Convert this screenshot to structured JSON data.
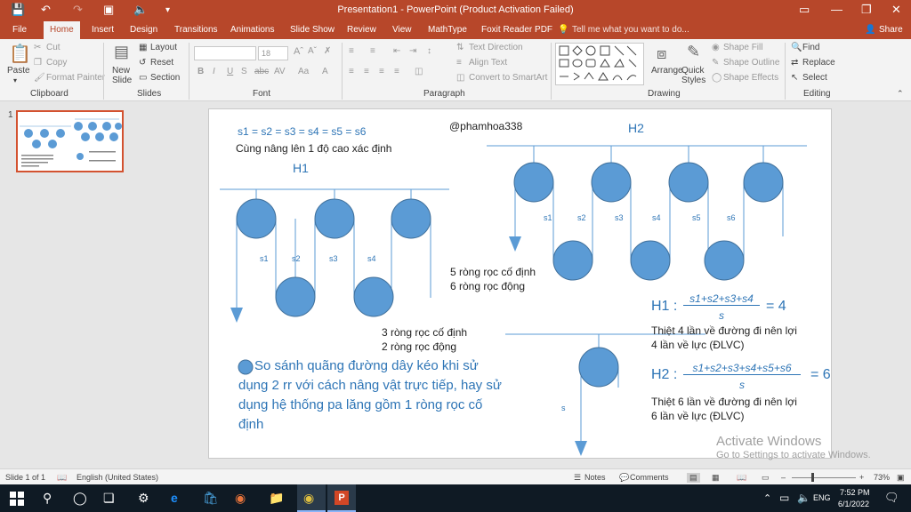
{
  "window": {
    "title": "Presentation1 - PowerPoint (Product Activation Failed)"
  },
  "tabs": [
    "File",
    "Home",
    "Insert",
    "Design",
    "Transitions",
    "Animations",
    "Slide Show",
    "Review",
    "View",
    "MathType",
    "Foxit Reader PDF"
  ],
  "tell_me": "Tell me what you want to do...",
  "share": "Share",
  "ribbon": {
    "paste": "Paste",
    "cut": "Cut",
    "copy": "Copy",
    "format_painter": "Format Painter",
    "new_slide": "New Slide",
    "layout": "Layout",
    "reset": "Reset",
    "section": "Section",
    "font_name": "",
    "font_size": "18",
    "text_direction": "Text Direction",
    "align_text": "Align Text",
    "convert_smartart": "Convert to SmartArt",
    "arrange": "Arrange",
    "quick_styles": "Quick Styles",
    "shape_fill": "Shape Fill",
    "shape_outline": "Shape Outline",
    "shape_effects": "Shape Effects",
    "find": "Find",
    "replace": "Replace",
    "select": "Select",
    "groups": {
      "clipboard": "Clipboard",
      "slides": "Slides",
      "font": "Font",
      "paragraph": "Paragraph",
      "drawing": "Drawing",
      "editing": "Editing"
    }
  },
  "thumbnail_number": "1",
  "slide": {
    "equal": "s1 = s2 = s3 = s4 = s5 = s6",
    "same_height": "Cùng nâng lên 1 độ cao xác định",
    "author": "@phamhoa338",
    "h1": "H1",
    "h2": "H2",
    "h1_labels": [
      "s1",
      "s2",
      "s3",
      "s4"
    ],
    "h2_labels": [
      "s1",
      "s2",
      "s3",
      "s4",
      "s5",
      "s6"
    ],
    "h2_count": [
      "5 ròng rọc cố định",
      "6 ròng rọc động"
    ],
    "h1_count": [
      "3 ròng rọc cố định",
      "2 ròng rọc động"
    ],
    "question": "So sánh quãng đường dây kéo khi sử dụng 2 rr  với cách nâng vật trực tiếp, hay sử dụng hệ thống pa lăng gồm 1 ròng rọc cố định",
    "single_label": "s",
    "f1_lhs": "H1 :",
    "f1_num": "s1+s2+s3+s4",
    "f1_den": "s",
    "f1_rhs": "= 4",
    "f1_note": [
      "Thiệt 4 lần về đường đi nên lợi",
      "4 lần về lực (ĐLVC)"
    ],
    "f2_lhs": "H2 :",
    "f2_num": "s1+s2+s3+s4+s5+s6",
    "f2_den": "s",
    "f2_rhs": "= 6",
    "f2_note": [
      "Thiệt 6 lần về đường đi nên lợi",
      "6 lần về lực (ĐLVC)"
    ]
  },
  "activate": {
    "line1": "Activate Windows",
    "line2": "Go to Settings to activate Windows."
  },
  "status": {
    "slide": "Slide 1 of 1",
    "language": "English (United States)",
    "notes": "Notes",
    "comments": "Comments",
    "zoom": "73%"
  },
  "taskbar": {
    "lang": "ENG",
    "time": "7:52 PM",
    "date": "6/1/2022"
  },
  "colors": {
    "accent": "#b7472a",
    "pulley": "#5b9bd5",
    "pulley_stroke": "#41719c",
    "heading": "#2e75b6"
  }
}
